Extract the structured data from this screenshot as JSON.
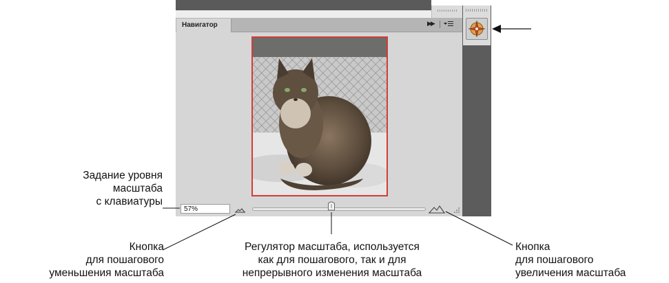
{
  "panel": {
    "tab_label": "Навигатор",
    "zoom_value": "57%",
    "zoom_slider_fraction": 0.44,
    "preview_image": "cat-photo",
    "frame_color": "#d33c35"
  },
  "icons": {
    "collapse": "double-chevron-right-icon",
    "panel_menu": "panel-menu-icon",
    "zoom_out": "small-mountains-icon",
    "zoom_in": "large-mountains-icon",
    "dock_navigator": "navigator-compass-icon"
  },
  "annotations": {
    "keyboard_zoom": [
      "Задание уровня",
      "масштаба",
      "с клавиатуры"
    ],
    "zoom_out_button": [
      "Кнопка",
      "для пошагового",
      "уменьшения масштаба"
    ],
    "zoom_slider": [
      "Регулятор масштаба, используется",
      "как для пошагового, так и для",
      "непрерывного изменения масштаба"
    ],
    "zoom_in_button": [
      "Кнопка",
      "для пошагового",
      "увеличения масштаба"
    ]
  }
}
